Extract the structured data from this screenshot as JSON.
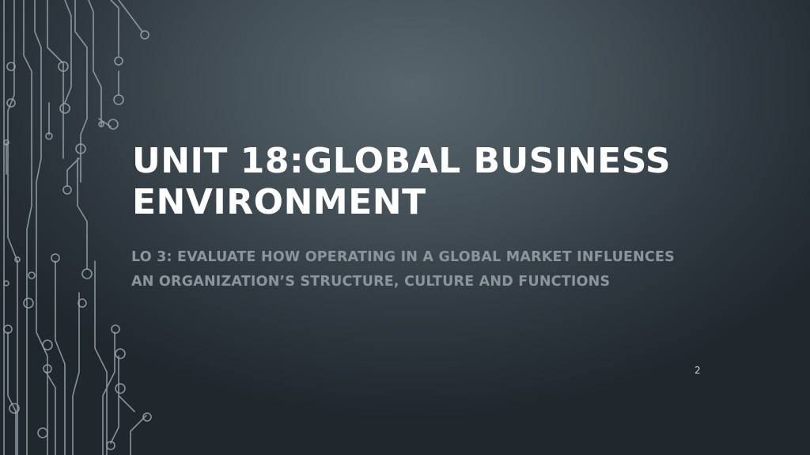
{
  "slide": {
    "title": "UNIT 18:GLOBAL BUSINESS ENVIRONMENT",
    "subtitle": "LO 3: EVALUATE HOW OPERATING IN A GLOBAL MARKET INFLUENCES AN ORGANIZATION’S STRUCTURE, CULTURE AND FUNCTIONS",
    "page_number": "2"
  },
  "decoration": {
    "icon": "circuit-board-lines-icon",
    "line_color": "#9aa6ad"
  },
  "colors": {
    "title": "#ffffff",
    "subtitle": "#8a959c",
    "background": "#3a454c"
  }
}
